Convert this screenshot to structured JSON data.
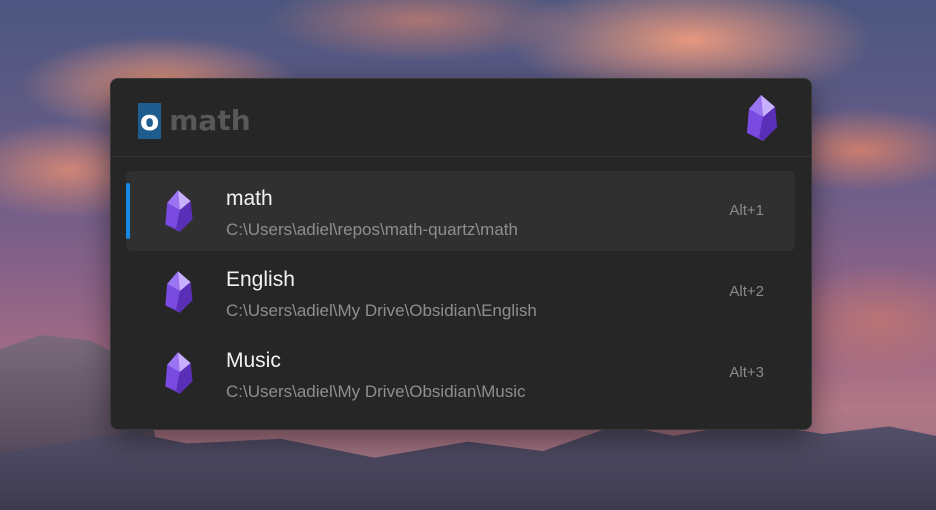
{
  "search": {
    "query_selected": "o",
    "query_rest": "math",
    "logo_icon": "obsidian-logo-icon"
  },
  "results": [
    {
      "title": "math",
      "path": "C:\\Users\\adiel\\repos\\math-quartz\\math",
      "shortcut": "Alt+1",
      "icon": "obsidian-logo-icon",
      "selected": true
    },
    {
      "title": "English",
      "path": "C:\\Users\\adiel\\My Drive\\Obsidian\\English",
      "shortcut": "Alt+2",
      "icon": "obsidian-logo-icon",
      "selected": false
    },
    {
      "title": "Music",
      "path": "C:\\Users\\adiel\\My Drive\\Obsidian\\Music",
      "shortcut": "Alt+3",
      "icon": "obsidian-logo-icon",
      "selected": false
    }
  ],
  "colors": {
    "accent": "#1688e8",
    "selection": "#1f5d8f",
    "window_bg": "#262626",
    "selected_row_bg": "#303030",
    "logo_purple": "#8b5cf6"
  }
}
